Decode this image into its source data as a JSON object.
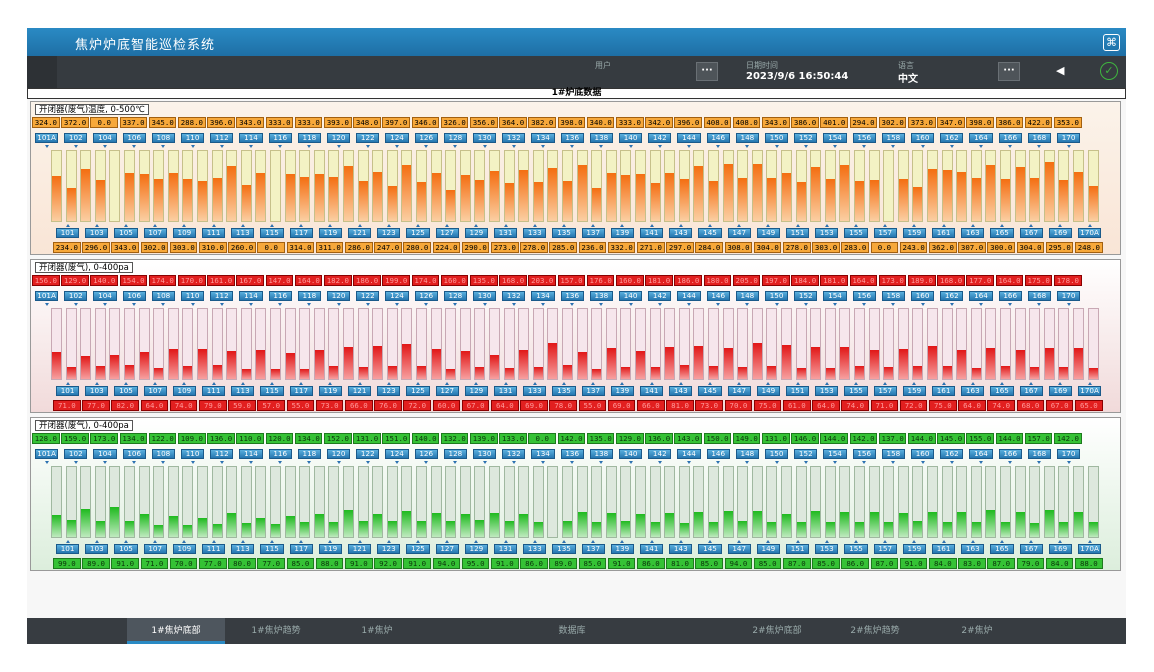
{
  "app_title": "焦炉炉底智能巡检系统",
  "fingerprint_icon": "fingerprint-icon",
  "infobar": {
    "user_label": "用户",
    "user_value": "",
    "datetime_label": "日期时间",
    "datetime_value": "2023/9/6 16:50:44",
    "language_label": "语言",
    "language_value": "中文",
    "more": "···",
    "back_icon": "back-arrow-icon",
    "ok_icon": "check-circle-icon"
  },
  "page_header": "1#炉底数据",
  "panels": [
    {
      "title": "开闭器(废气)温度, 0-500℃",
      "scale_max": 500,
      "top_labels": [
        "101A",
        "102",
        "104",
        "106",
        "108",
        "110",
        "112",
        "114",
        "116",
        "118",
        "120",
        "122",
        "124",
        "126",
        "128",
        "130",
        "132",
        "134",
        "136",
        "138",
        "140",
        "142",
        "144",
        "146",
        "148",
        "150",
        "152",
        "154",
        "156",
        "158",
        "160",
        "162",
        "164",
        "166",
        "168",
        "170"
      ],
      "bottom_labels": [
        "101",
        "103",
        "105",
        "107",
        "109",
        "111",
        "113",
        "115",
        "117",
        "119",
        "121",
        "123",
        "125",
        "127",
        "129",
        "131",
        "133",
        "135",
        "137",
        "139",
        "141",
        "143",
        "145",
        "147",
        "149",
        "151",
        "153",
        "155",
        "157",
        "159",
        "161",
        "163",
        "165",
        "167",
        "169",
        "170A"
      ],
      "top_values": [
        "324.0",
        "372.0",
        "0.0",
        "337.0",
        "345.0",
        "288.0",
        "396.0",
        "343.0",
        "333.0",
        "333.0",
        "393.0",
        "348.0",
        "397.0",
        "346.0",
        "326.0",
        "356.0",
        "364.0",
        "382.0",
        "398.0",
        "340.0",
        "333.0",
        "342.0",
        "396.0",
        "408.0",
        "408.0",
        "343.0",
        "386.0",
        "401.0",
        "294.0",
        "302.0",
        "373.0",
        "347.0",
        "398.0",
        "386.0",
        "422.0",
        "353.0"
      ],
      "bottom_values": [
        "234.0",
        "296.0",
        "343.0",
        "302.0",
        "303.0",
        "310.0",
        "260.0",
        "0.0",
        "314.0",
        "311.0",
        "286.0",
        "247.0",
        "280.0",
        "224.0",
        "290.0",
        "273.0",
        "278.0",
        "285.0",
        "236.0",
        "332.0",
        "271.0",
        "297.0",
        "284.0",
        "308.0",
        "304.0",
        "278.0",
        "303.0",
        "283.0",
        "0.0",
        "243.0",
        "362.0",
        "307.0",
        "300.0",
        "304.0",
        "295.0",
        "248.0"
      ]
    },
    {
      "title": "开闭器(废气), 0-400pa",
      "scale_max": 400,
      "top_labels": [
        "101A",
        "102",
        "104",
        "106",
        "108",
        "110",
        "112",
        "114",
        "116",
        "118",
        "120",
        "122",
        "124",
        "126",
        "128",
        "130",
        "132",
        "134",
        "136",
        "138",
        "140",
        "142",
        "144",
        "146",
        "148",
        "150",
        "152",
        "154",
        "156",
        "158",
        "160",
        "162",
        "164",
        "166",
        "168",
        "170"
      ],
      "bottom_labels": [
        "101",
        "103",
        "105",
        "107",
        "109",
        "111",
        "113",
        "115",
        "117",
        "119",
        "121",
        "123",
        "125",
        "127",
        "129",
        "131",
        "133",
        "135",
        "137",
        "139",
        "141",
        "143",
        "145",
        "147",
        "149",
        "151",
        "153",
        "155",
        "157",
        "159",
        "161",
        "163",
        "165",
        "167",
        "169",
        "170A"
      ],
      "top_values": [
        "156.0",
        "129.0",
        "140.0",
        "154.0",
        "174.0",
        "170.0",
        "161.0",
        "167.0",
        "147.0",
        "164.0",
        "182.0",
        "186.0",
        "199.0",
        "174.0",
        "160.0",
        "135.0",
        "168.0",
        "203.0",
        "157.0",
        "176.0",
        "160.0",
        "181.0",
        "186.0",
        "180.0",
        "205.0",
        "197.0",
        "184.0",
        "181.0",
        "164.0",
        "173.0",
        "189.0",
        "168.0",
        "177.0",
        "164.0",
        "175.0",
        "178.0"
      ],
      "bottom_values": [
        "71.0",
        "77.0",
        "82.0",
        "64.0",
        "74.0",
        "79.0",
        "59.0",
        "57.0",
        "55.0",
        "73.0",
        "66.0",
        "76.0",
        "72.0",
        "60.0",
        "67.0",
        "64.0",
        "69.0",
        "78.0",
        "55.0",
        "69.0",
        "66.0",
        "81.0",
        "73.0",
        "70.0",
        "75.0",
        "61.0",
        "64.0",
        "74.0",
        "71.0",
        "72.0",
        "75.0",
        "64.0",
        "74.0",
        "68.0",
        "67.0",
        "65.0"
      ]
    },
    {
      "title": "开闭器(废气), 0-400pa",
      "scale_max": 400,
      "top_labels": [
        "101A",
        "102",
        "104",
        "106",
        "108",
        "110",
        "112",
        "114",
        "116",
        "118",
        "120",
        "122",
        "124",
        "126",
        "128",
        "130",
        "132",
        "134",
        "136",
        "138",
        "140",
        "142",
        "144",
        "146",
        "148",
        "150",
        "152",
        "154",
        "156",
        "158",
        "160",
        "162",
        "164",
        "166",
        "168",
        "170"
      ],
      "bottom_labels": [
        "101",
        "103",
        "105",
        "107",
        "109",
        "111",
        "113",
        "115",
        "117",
        "119",
        "121",
        "123",
        "125",
        "127",
        "129",
        "131",
        "133",
        "135",
        "137",
        "139",
        "141",
        "143",
        "145",
        "147",
        "149",
        "151",
        "153",
        "155",
        "157",
        "159",
        "161",
        "163",
        "165",
        "167",
        "169",
        "170A"
      ],
      "top_values": [
        "128.0",
        "159.0",
        "173.0",
        "134.0",
        "122.0",
        "109.0",
        "136.0",
        "110.0",
        "120.0",
        "134.0",
        "152.0",
        "131.0",
        "151.0",
        "140.0",
        "132.0",
        "139.0",
        "133.0",
        "0.0",
        "142.0",
        "135.0",
        "129.0",
        "136.0",
        "143.0",
        "150.0",
        "149.0",
        "131.0",
        "146.0",
        "144.0",
        "142.0",
        "137.0",
        "144.0",
        "145.0",
        "155.0",
        "144.0",
        "157.0",
        "142.0"
      ],
      "bottom_values": [
        "99.0",
        "89.0",
        "91.0",
        "71.0",
        "70.0",
        "77.0",
        "80.0",
        "77.0",
        "85.0",
        "88.0",
        "91.0",
        "92.0",
        "91.0",
        "94.0",
        "95.0",
        "91.0",
        "86.0",
        "89.0",
        "85.0",
        "91.0",
        "86.0",
        "81.0",
        "85.0",
        "94.0",
        "85.0",
        "87.0",
        "85.0",
        "86.0",
        "87.0",
        "91.0",
        "84.0",
        "83.0",
        "87.0",
        "79.0",
        "84.0",
        "88.0"
      ]
    }
  ],
  "nav": [
    "1#焦炉底部",
    "1#焦炉趋势",
    "1#焦炉",
    "数据库",
    "2#焦炉底部",
    "2#焦炉趋势",
    "2#焦炉"
  ],
  "nav_active": 0
}
